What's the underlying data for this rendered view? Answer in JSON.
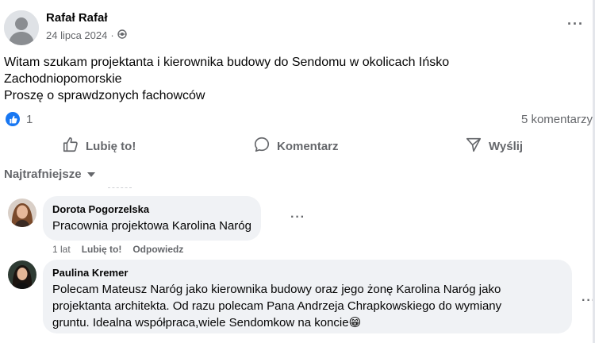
{
  "post": {
    "author": "Rafał Rafał",
    "date": "24 lipca 2024",
    "separator": "·",
    "text_lines": [
      "Witam szukam projektanta i kierownika budowy do Sendomu w okolicach Ińsko",
      "Zachodniopomorskie",
      "Proszę o sprawdzonych fachowców"
    ],
    "reaction_count": "1",
    "comment_count": "5 komentarzy",
    "more_label": "···"
  },
  "actions": {
    "like": "Lubię to!",
    "comment": "Komentarz",
    "share": "Wyślij"
  },
  "sort": {
    "label": "Najtrafniejsze"
  },
  "comments": [
    {
      "author": "Dorota Pogorzelska",
      "text": "Pracownia projektowa Karolina Naróg",
      "time": "1 lat",
      "like": "Lubię to!",
      "reply": "Odpowiedz",
      "more": "···"
    },
    {
      "author": "Paulina Kremer",
      "text_lines": [
        "Polecam Mateusz Naróg jako kierownika budowy oraz jego żonę Karolina Naróg jako",
        "projektanta architekta. Od razu polecam Pana Andrzeja Chrapkowskiego do wymiany",
        "gruntu. Idealna współpraca,wiele Sendomkow na koncie"
      ],
      "emoji": "😁",
      "more": "···"
    }
  ],
  "colors": {
    "primary_blue": "#1877f2",
    "secondary_text": "#65676b",
    "bubble_bg": "#f0f2f5"
  }
}
